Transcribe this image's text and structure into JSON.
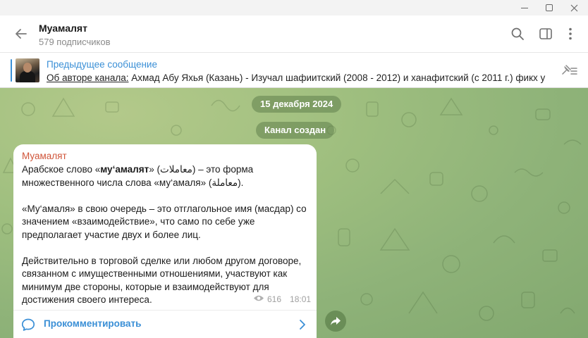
{
  "window": {
    "controls": [
      "minimize-icon",
      "maximize-icon",
      "close-icon"
    ]
  },
  "header": {
    "title": "Муамалят",
    "subtitle": "579 подписчиков",
    "icons": [
      "back-arrow-icon",
      "search-icon",
      "sidebar-toggle-icon",
      "more-vertical-icon"
    ]
  },
  "pinned": {
    "title": "Предыдущее сообщение",
    "text_prefix": "Об авторе канала:",
    "text_rest": "  Ахмад Абу Яхья (Казань)  - Изучал шафиитский (2008 - 2012) и ханафитский (с 2011 г.) фикх у с...",
    "icon": "pinned-list-icon"
  },
  "chat": {
    "date_pill": "15 декабря 2024",
    "service_pill": "Канал создан",
    "message": {
      "author": "Муамалят",
      "p1_before": "Арабское слово «",
      "p1_bold": "му‘амалят",
      "p1_after": "» (معاملات) – это форма множественного числа слова «му‘амаля» (معاملة).",
      "p2": "«Му‘амаля» в свою очередь – это отглагольное имя (масдар) со значением «взаимодействие», что само по себе уже предполагает участие двух и более лиц.",
      "p3": "Действительно в торговой сделке или любом другом договоре, связанном с имущественными отношениями, участвуют как минимум две стороны, которые и взаимодействуют для достижения своего интереса.",
      "views": "616",
      "time": "18:01",
      "comment_label": "Прокомментировать"
    }
  },
  "colors": {
    "accent": "#3a8fd6",
    "author": "#d0553a",
    "chat_bg": "#9fbf7f"
  }
}
